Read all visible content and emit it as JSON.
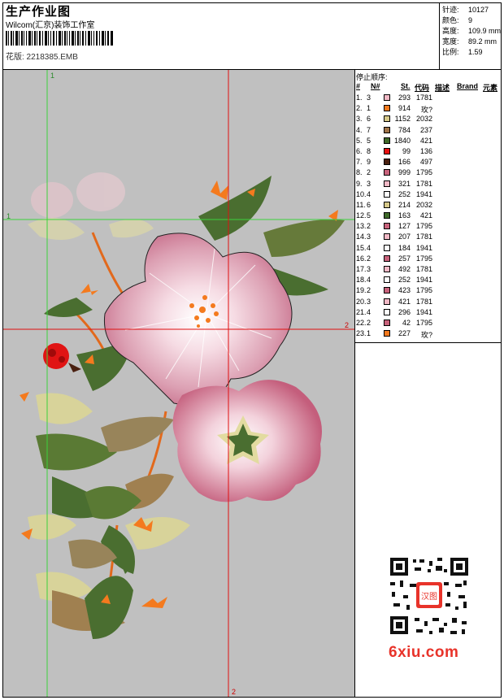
{
  "header": {
    "title": "生产作业图",
    "studio": "Wilcom(汇京)装饰工作室",
    "design_label": "花版: 2218385.EMB"
  },
  "stats": [
    {
      "label": "针迹:",
      "value": "10127"
    },
    {
      "label": "颜色:",
      "value": "9"
    },
    {
      "label": "高度:",
      "value": "109.9 mm"
    },
    {
      "label": "宽度:",
      "value": "89.2 mm"
    },
    {
      "label": "比例:",
      "value": "1.59"
    }
  ],
  "sequence": {
    "title": "停止顺序:",
    "headers": {
      "idx": "#",
      "n": "N#",
      "st": "St.",
      "code": "代码",
      "desc": "描述",
      "brand": "Brand",
      "elem": "元素"
    },
    "rows": [
      {
        "idx": "1.",
        "n": "3",
        "color": "#f2b9c6",
        "st": "293",
        "code": "1781"
      },
      {
        "idx": "2.",
        "n": "1",
        "color": "#f47a1e",
        "st": "914",
        "code": "玫?"
      },
      {
        "idx": "3.",
        "n": "6",
        "color": "#d6c98a",
        "st": "1152",
        "code": "2032"
      },
      {
        "idx": "4.",
        "n": "7",
        "color": "#a0744a",
        "st": "784",
        "code": "237"
      },
      {
        "idx": "5.",
        "n": "5",
        "color": "#3f6a2a",
        "st": "1840",
        "code": "421"
      },
      {
        "idx": "6.",
        "n": "8",
        "color": "#e81010",
        "st": "99",
        "code": "136"
      },
      {
        "idx": "7.",
        "n": "9",
        "color": "#4a2010",
        "st": "166",
        "code": "497"
      },
      {
        "idx": "8.",
        "n": "2",
        "color": "#c8637c",
        "st": "999",
        "code": "1795"
      },
      {
        "idx": "9.",
        "n": "3",
        "color": "#f2b9c6",
        "st": "321",
        "code": "1781"
      },
      {
        "idx": "10.",
        "n": "4",
        "color": "#ffffff",
        "st": "252",
        "code": "1941"
      },
      {
        "idx": "11.",
        "n": "6",
        "color": "#d6c98a",
        "st": "214",
        "code": "2032"
      },
      {
        "idx": "12.",
        "n": "5",
        "color": "#3f6a2a",
        "st": "163",
        "code": "421"
      },
      {
        "idx": "13.",
        "n": "2",
        "color": "#c8637c",
        "st": "127",
        "code": "1795"
      },
      {
        "idx": "14.",
        "n": "3",
        "color": "#f2b9c6",
        "st": "207",
        "code": "1781"
      },
      {
        "idx": "15.",
        "n": "4",
        "color": "#ffffff",
        "st": "184",
        "code": "1941"
      },
      {
        "idx": "16.",
        "n": "2",
        "color": "#c8637c",
        "st": "257",
        "code": "1795"
      },
      {
        "idx": "17.",
        "n": "3",
        "color": "#f2b9c6",
        "st": "492",
        "code": "1781"
      },
      {
        "idx": "18.",
        "n": "4",
        "color": "#ffffff",
        "st": "252",
        "code": "1941"
      },
      {
        "idx": "19.",
        "n": "2",
        "color": "#c8637c",
        "st": "423",
        "code": "1795"
      },
      {
        "idx": "20.",
        "n": "3",
        "color": "#f2b9c6",
        "st": "421",
        "code": "1781"
      },
      {
        "idx": "21.",
        "n": "4",
        "color": "#ffffff",
        "st": "296",
        "code": "1941"
      },
      {
        "idx": "22.",
        "n": "2",
        "color": "#c8637c",
        "st": "42",
        "code": "1795"
      },
      {
        "idx": "23.",
        "n": "1",
        "color": "#f47a1e",
        "st": "227",
        "code": "玫?"
      }
    ]
  },
  "guides": {
    "v1_label": "1",
    "h1_label": "1",
    "h2_label": "2",
    "v2_label": "2"
  },
  "watermark": {
    "text": "6xiu.com",
    "qr_badge": "汉图"
  },
  "colors": {
    "canvas": "#c0c0c0",
    "guide_green": "#3cd23c",
    "guide_red": "#e01010",
    "watermark": "#e8332a"
  }
}
